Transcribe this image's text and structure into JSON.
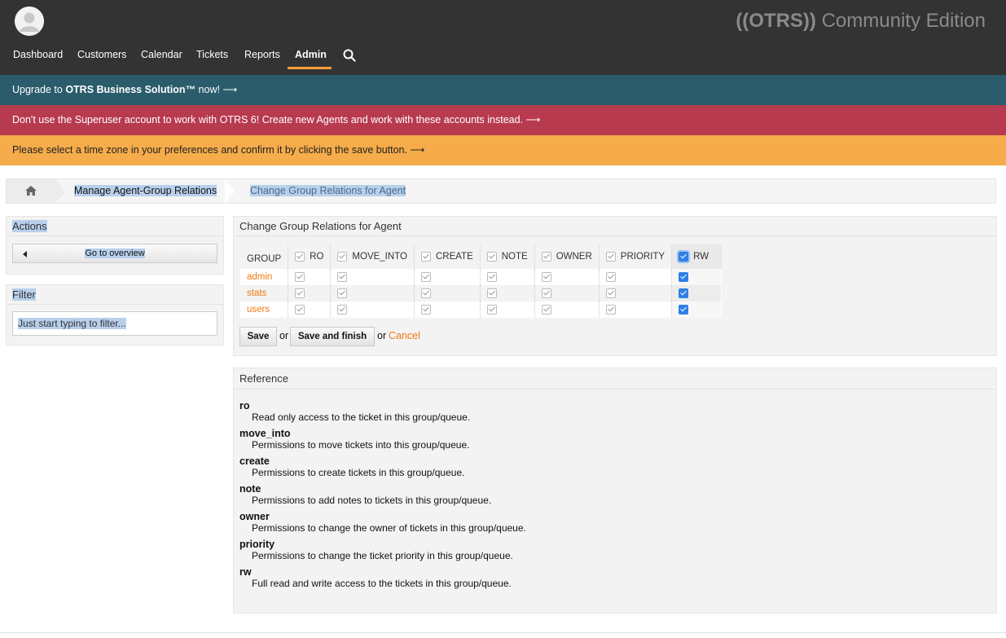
{
  "header": {
    "logo_main": "((OTRS))",
    "logo_suffix": " Community Edition",
    "nav": [
      {
        "label": "Dashboard"
      },
      {
        "label": "Customers"
      },
      {
        "label": "Calendar"
      },
      {
        "label": "Tickets"
      },
      {
        "label": "Reports"
      },
      {
        "label": "Admin",
        "active": true
      }
    ],
    "search_icon": "search-icon"
  },
  "notices": {
    "upgrade_prefix": "Upgrade to ",
    "upgrade_bold": "OTRS Business Solution™",
    "upgrade_suffix": " now! ⟶",
    "superuser": "Don't use the Superuser account to work with OTRS 6! Create new Agents and work with these accounts instead. ⟶",
    "timezone": "Please select a time zone in your preferences and confirm it by clicking the save button. ⟶"
  },
  "breadcrumb": {
    "home_icon": "home-icon",
    "items": [
      "Manage Agent-Group Relations",
      "Change Group Relations for Agent"
    ]
  },
  "sidebar": {
    "actions_title": "Actions",
    "overview_button": "Go to overview",
    "filter_title": "Filter",
    "filter_placeholder": "Just start typing to filter..."
  },
  "main": {
    "title": "Change Group Relations for Agent",
    "columns": [
      "GROUP",
      "RO",
      "MOVE_INTO",
      "CREATE",
      "NOTE",
      "OWNER",
      "PRIORITY",
      "RW"
    ],
    "rows": [
      {
        "group": "admin",
        "rw": true
      },
      {
        "group": "stats",
        "rw": true
      },
      {
        "group": "users",
        "rw": true
      }
    ],
    "save_label": "Save",
    "or_label": "or",
    "save_finish_label": "Save and finish",
    "or_label_2": "or",
    "cancel_label": "Cancel"
  },
  "reference": {
    "title": "Reference",
    "items": [
      {
        "term": "ro",
        "desc": "Read only access to the ticket in this group/queue."
      },
      {
        "term": "move_into",
        "desc": "Permissions to move tickets into this group/queue."
      },
      {
        "term": "create",
        "desc": "Permissions to create tickets in this group/queue."
      },
      {
        "term": "note",
        "desc": "Permissions to add notes to tickets in this group/queue."
      },
      {
        "term": "owner",
        "desc": "Permissions to change the owner of tickets in this group/queue."
      },
      {
        "term": "priority",
        "desc": "Permissions to change the ticket priority in this group/queue."
      },
      {
        "term": "rw",
        "desc": "Full read and write access to the tickets in this group/queue."
      }
    ]
  },
  "colors": {
    "topbar": "#333333",
    "upgrade_bar": "#2a5c6b",
    "superuser_bar": "#b83a4f",
    "timezone_bar": "#f6ac4a",
    "accent": "#f07a12"
  }
}
